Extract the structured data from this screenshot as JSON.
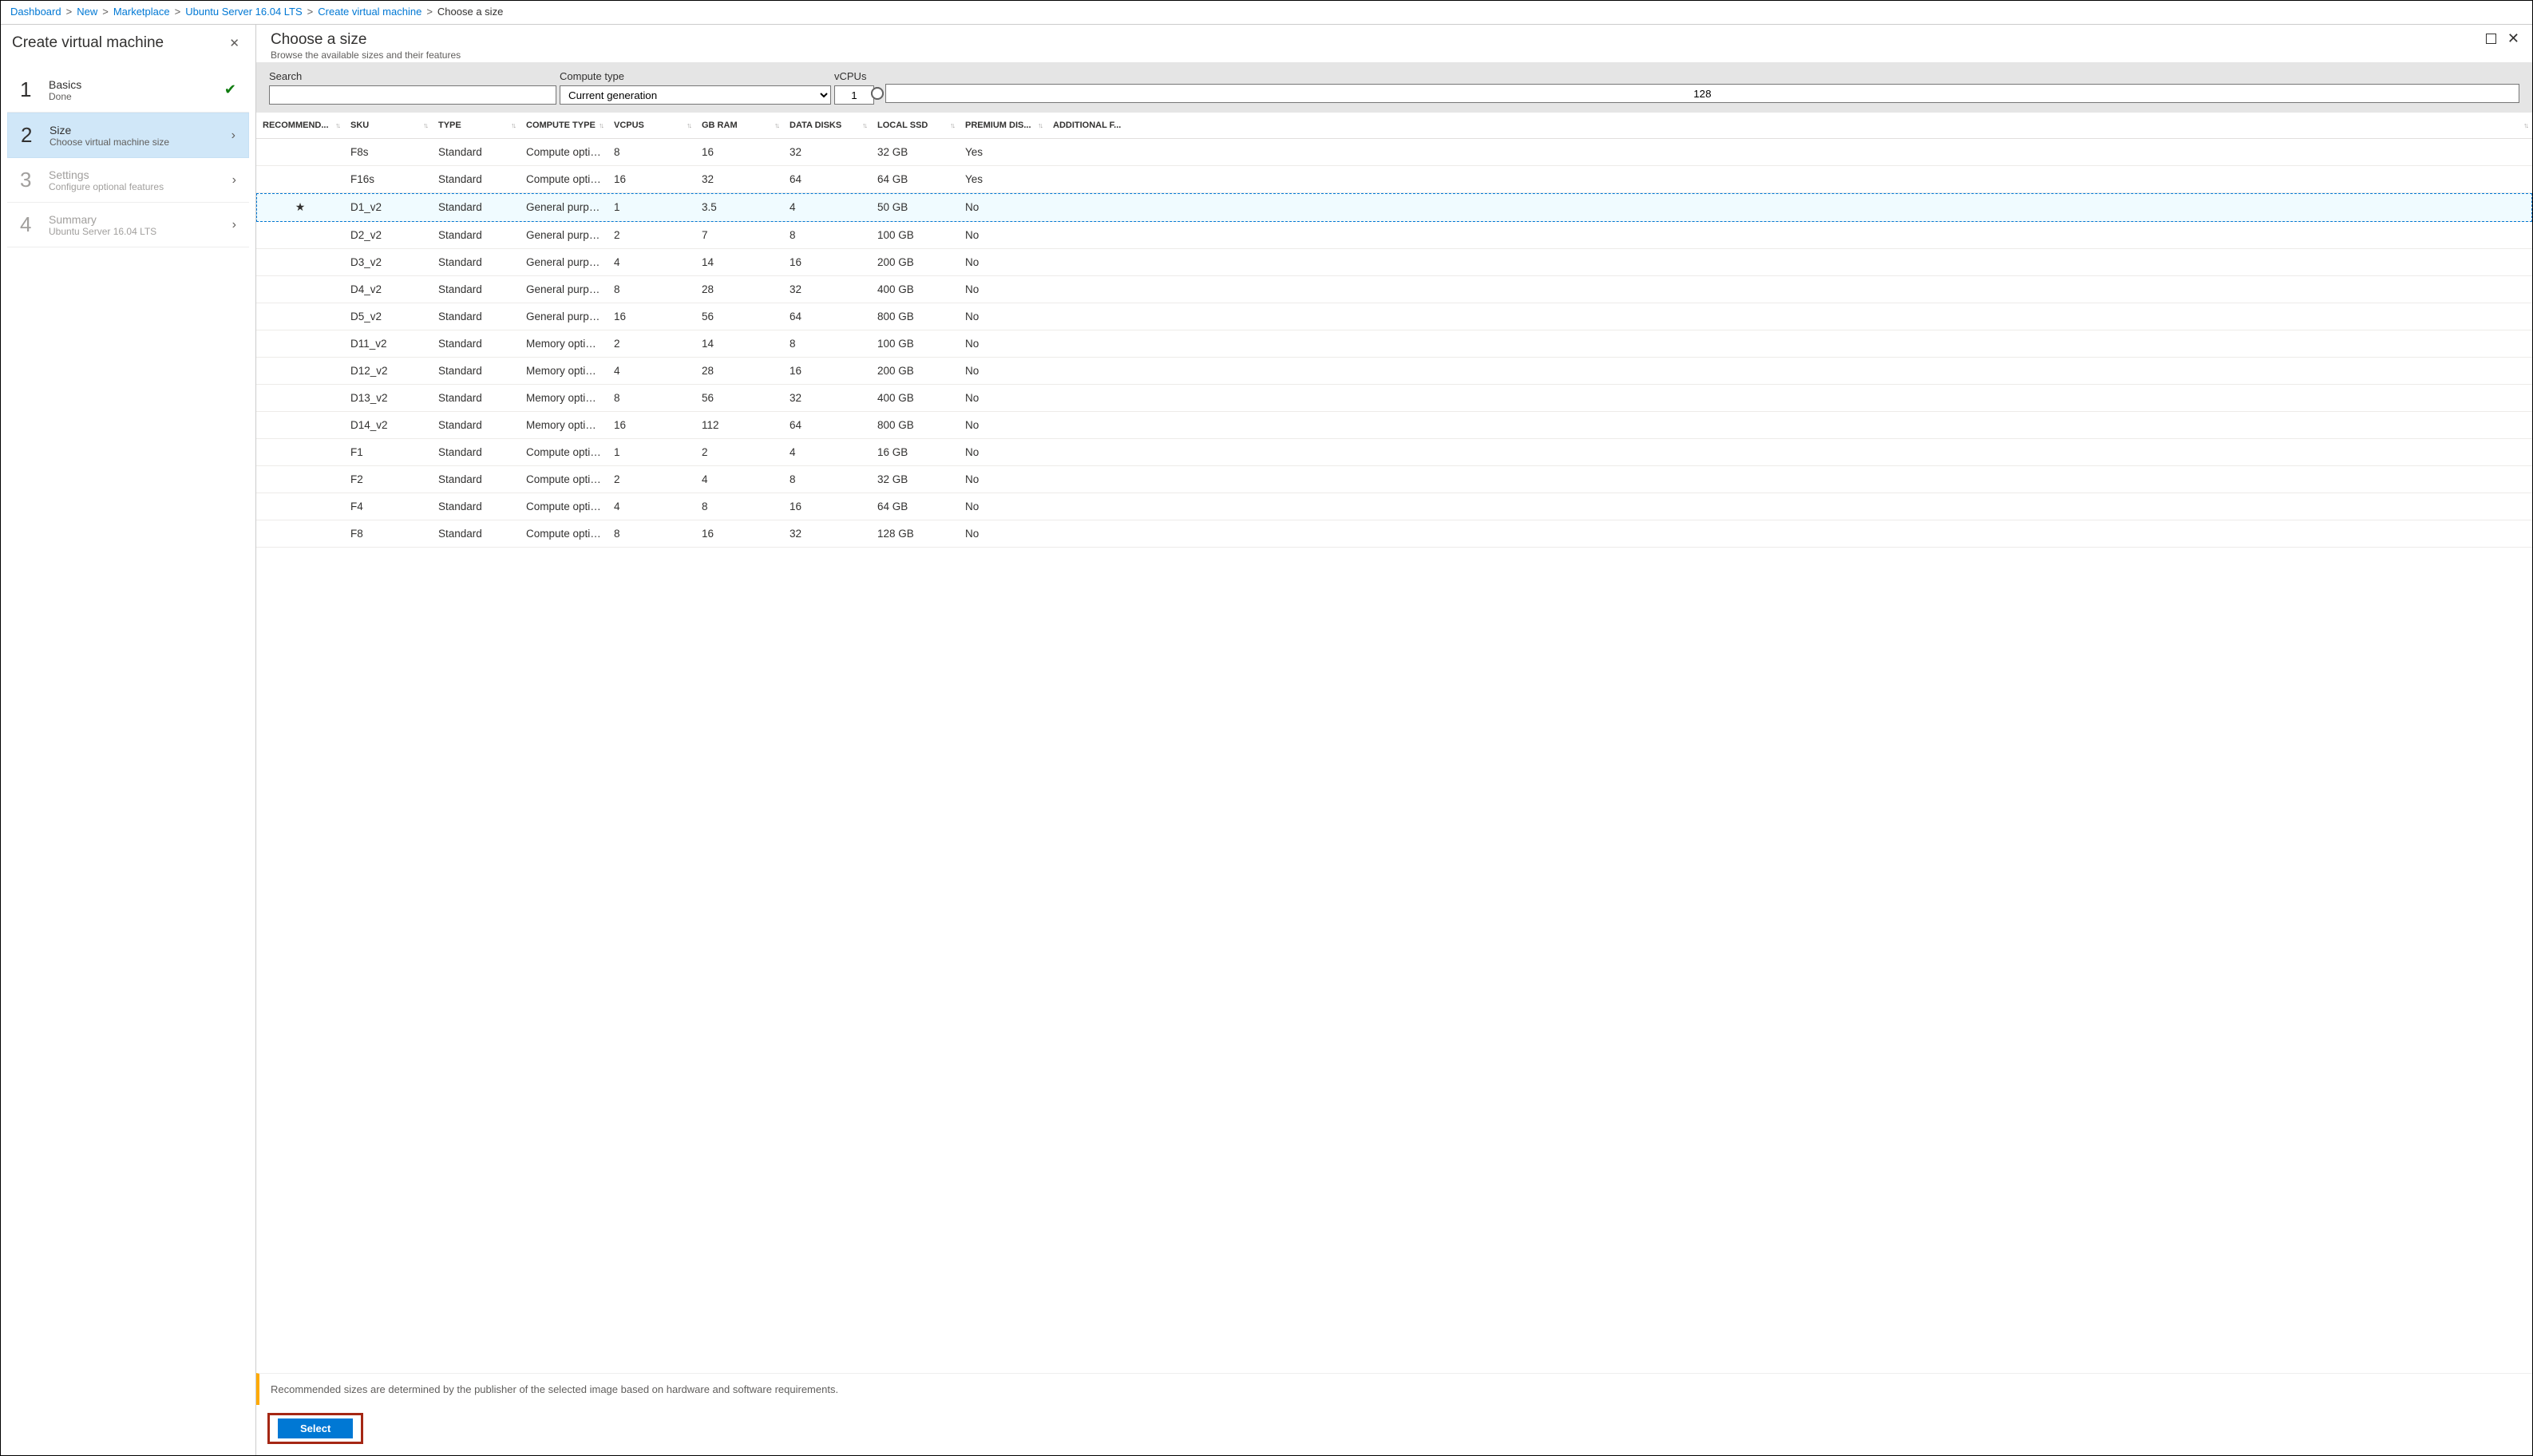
{
  "breadcrumbs": [
    "Dashboard",
    "New",
    "Marketplace",
    "Ubuntu Server 16.04 LTS",
    "Create virtual machine",
    "Choose a size"
  ],
  "left": {
    "title": "Create virtual machine",
    "steps": [
      {
        "num": "1",
        "title": "Basics",
        "sub": "Done",
        "status": "done"
      },
      {
        "num": "2",
        "title": "Size",
        "sub": "Choose virtual machine size",
        "status": "active"
      },
      {
        "num": "3",
        "title": "Settings",
        "sub": "Configure optional features",
        "status": "disabled"
      },
      {
        "num": "4",
        "title": "Summary",
        "sub": "Ubuntu Server 16.04 LTS",
        "status": "disabled"
      }
    ]
  },
  "right": {
    "title": "Choose a size",
    "subtitle": "Browse the available sizes and their features",
    "filters": {
      "search_label": "Search",
      "search_value": "",
      "compute_label": "Compute type",
      "compute_value": "Current generation",
      "vcpu_label": "vCPUs",
      "vcpu_min": "1",
      "vcpu_max": "128"
    },
    "columns": [
      "RECOMMEND...",
      "SKU",
      "TYPE",
      "COMPUTE TYPE",
      "VCPUS",
      "GB RAM",
      "DATA DISKS",
      "LOCAL SSD",
      "PREMIUM DIS...",
      "ADDITIONAL F..."
    ],
    "rows": [
      {
        "rec": "",
        "sku": "F8s",
        "type": "Standard",
        "ct": "Compute optimiz",
        "vc": "8",
        "gb": "16",
        "dd": "32",
        "ls": "32 GB",
        "pd": "Yes",
        "af": ""
      },
      {
        "rec": "",
        "sku": "F16s",
        "type": "Standard",
        "ct": "Compute optimiz",
        "vc": "16",
        "gb": "32",
        "dd": "64",
        "ls": "64 GB",
        "pd": "Yes",
        "af": ""
      },
      {
        "rec": "★",
        "sku": "D1_v2",
        "type": "Standard",
        "ct": "General purpose",
        "vc": "1",
        "gb": "3.5",
        "dd": "4",
        "ls": "50 GB",
        "pd": "No",
        "af": "",
        "selected": true
      },
      {
        "rec": "",
        "sku": "D2_v2",
        "type": "Standard",
        "ct": "General purpose",
        "vc": "2",
        "gb": "7",
        "dd": "8",
        "ls": "100 GB",
        "pd": "No",
        "af": ""
      },
      {
        "rec": "",
        "sku": "D3_v2",
        "type": "Standard",
        "ct": "General purpose",
        "vc": "4",
        "gb": "14",
        "dd": "16",
        "ls": "200 GB",
        "pd": "No",
        "af": ""
      },
      {
        "rec": "",
        "sku": "D4_v2",
        "type": "Standard",
        "ct": "General purpose",
        "vc": "8",
        "gb": "28",
        "dd": "32",
        "ls": "400 GB",
        "pd": "No",
        "af": ""
      },
      {
        "rec": "",
        "sku": "D5_v2",
        "type": "Standard",
        "ct": "General purpose",
        "vc": "16",
        "gb": "56",
        "dd": "64",
        "ls": "800 GB",
        "pd": "No",
        "af": ""
      },
      {
        "rec": "",
        "sku": "D11_v2",
        "type": "Standard",
        "ct": "Memory optimize",
        "vc": "2",
        "gb": "14",
        "dd": "8",
        "ls": "100 GB",
        "pd": "No",
        "af": ""
      },
      {
        "rec": "",
        "sku": "D12_v2",
        "type": "Standard",
        "ct": "Memory optimize",
        "vc": "4",
        "gb": "28",
        "dd": "16",
        "ls": "200 GB",
        "pd": "No",
        "af": ""
      },
      {
        "rec": "",
        "sku": "D13_v2",
        "type": "Standard",
        "ct": "Memory optimize",
        "vc": "8",
        "gb": "56",
        "dd": "32",
        "ls": "400 GB",
        "pd": "No",
        "af": ""
      },
      {
        "rec": "",
        "sku": "D14_v2",
        "type": "Standard",
        "ct": "Memory optimize",
        "vc": "16",
        "gb": "112",
        "dd": "64",
        "ls": "800 GB",
        "pd": "No",
        "af": ""
      },
      {
        "rec": "",
        "sku": "F1",
        "type": "Standard",
        "ct": "Compute optimiz",
        "vc": "1",
        "gb": "2",
        "dd": "4",
        "ls": "16 GB",
        "pd": "No",
        "af": ""
      },
      {
        "rec": "",
        "sku": "F2",
        "type": "Standard",
        "ct": "Compute optimiz",
        "vc": "2",
        "gb": "4",
        "dd": "8",
        "ls": "32 GB",
        "pd": "No",
        "af": ""
      },
      {
        "rec": "",
        "sku": "F4",
        "type": "Standard",
        "ct": "Compute optimiz",
        "vc": "4",
        "gb": "8",
        "dd": "16",
        "ls": "64 GB",
        "pd": "No",
        "af": ""
      },
      {
        "rec": "",
        "sku": "F8",
        "type": "Standard",
        "ct": "Compute optimiz",
        "vc": "8",
        "gb": "16",
        "dd": "32",
        "ls": "128 GB",
        "pd": "No",
        "af": ""
      }
    ],
    "info": "Recommended sizes are determined by the publisher of the selected image based on hardware and software requirements.",
    "select_label": "Select"
  }
}
